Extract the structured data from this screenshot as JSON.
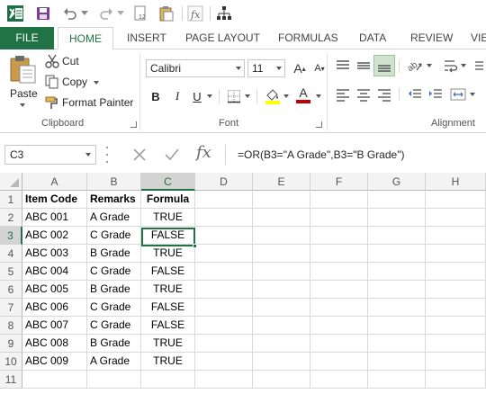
{
  "app": {
    "name": "Microsoft Excel",
    "accent": "#217346"
  },
  "qat": {
    "icons": [
      "excel-logo-icon",
      "save-icon",
      "undo-icon",
      "redo-icon",
      "page-number-icon",
      "paste-icon",
      "insert-function-icon",
      "hierarchy-icon"
    ]
  },
  "tabs": [
    {
      "label": "FILE",
      "active": false
    },
    {
      "label": "HOME",
      "active": true
    },
    {
      "label": "INSERT",
      "active": false
    },
    {
      "label": "PAGE LAYOUT",
      "active": false
    },
    {
      "label": "FORMULAS",
      "active": false
    },
    {
      "label": "DATA",
      "active": false
    },
    {
      "label": "REVIEW",
      "active": false
    },
    {
      "label": "VIE",
      "active": false
    }
  ],
  "ribbon": {
    "clipboard": {
      "paste_label": "Paste",
      "cut_label": "Cut",
      "copy_label": "Copy",
      "format_painter_label": "Format Painter",
      "group_label": "Clipboard"
    },
    "font": {
      "font_name": "Calibri",
      "font_size": "11",
      "bold": "B",
      "italic": "I",
      "underline": "U",
      "grow": "A",
      "shrink": "A",
      "font_color_letter": "A",
      "group_label": "Font"
    },
    "alignment": {
      "group_label": "Alignment"
    }
  },
  "formula_bar": {
    "name_box": "C3",
    "formula": "=OR(B3=\"A Grade\",B3=\"B Grade\")",
    "fx_label": "fx"
  },
  "sheet": {
    "columns": [
      "A",
      "B",
      "C",
      "D",
      "E",
      "F",
      "G",
      "H"
    ],
    "selected_column": "C",
    "selected_row": "3",
    "active_cell": "C3",
    "rows": [
      {
        "num": "1",
        "a": "Item Code",
        "b": "Remarks",
        "c": "Formula"
      },
      {
        "num": "2",
        "a": "ABC 001",
        "b": "A Grade",
        "c": "TRUE"
      },
      {
        "num": "3",
        "a": "ABC 002",
        "b": "C Grade",
        "c": "FALSE"
      },
      {
        "num": "4",
        "a": "ABC 003",
        "b": "B Grade",
        "c": "TRUE"
      },
      {
        "num": "5",
        "a": "ABC 004",
        "b": "C Grade",
        "c": "FALSE"
      },
      {
        "num": "6",
        "a": "ABC 005",
        "b": "B Grade",
        "c": "TRUE"
      },
      {
        "num": "7",
        "a": "ABC 006",
        "b": "C Grade",
        "c": "FALSE"
      },
      {
        "num": "8",
        "a": "ABC 007",
        "b": "C Grade",
        "c": "FALSE"
      },
      {
        "num": "9",
        "a": "ABC 008",
        "b": "B Grade",
        "c": "TRUE"
      },
      {
        "num": "10",
        "a": "ABC 009",
        "b": "A Grade",
        "c": "TRUE"
      },
      {
        "num": "11",
        "a": "",
        "b": "",
        "c": ""
      }
    ]
  }
}
